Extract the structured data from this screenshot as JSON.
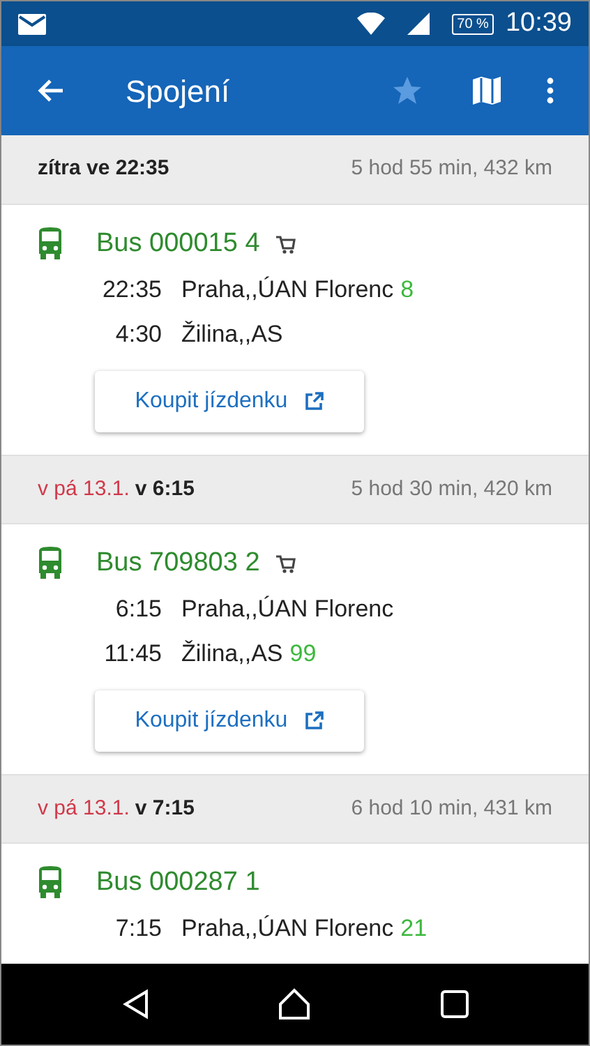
{
  "status_bar": {
    "battery": "70 %",
    "time": "10:39"
  },
  "app_bar": {
    "title": "Spojení",
    "favorite": false
  },
  "connections": [
    {
      "header": {
        "time": "zítra ve 22:35",
        "summary": "5 hod 55 min, 432 km"
      },
      "line": "Bus 000015 4",
      "cart": true,
      "stops": [
        {
          "time": "22:35",
          "station": "Praha,,ÚAN Florenc",
          "platform": "8"
        },
        {
          "time": "4:30",
          "station": "Žilina,,AS"
        }
      ],
      "button": "Koupit jízdenku"
    },
    {
      "header": {
        "day": "v pá 13.1.",
        "time": "v 6:15",
        "summary": "5 hod 30 min, 420 km"
      },
      "line": "Bus 709803 2",
      "cart": true,
      "stops": [
        {
          "time": "6:15",
          "station": "Praha,,ÚAN Florenc"
        },
        {
          "time": "11:45",
          "station": "Žilina,,AS",
          "platform": "99"
        }
      ],
      "button": "Koupit jízdenku"
    },
    {
      "header": {
        "day": "v pá 13.1.",
        "time": "v 7:15",
        "summary": "6 hod 10 min, 431 km"
      },
      "line": "Bus 000287 1",
      "cart": false,
      "stops": [
        {
          "time": "7:15",
          "station": "Praha,,ÚAN Florenc",
          "platform": "21"
        }
      ]
    }
  ]
}
